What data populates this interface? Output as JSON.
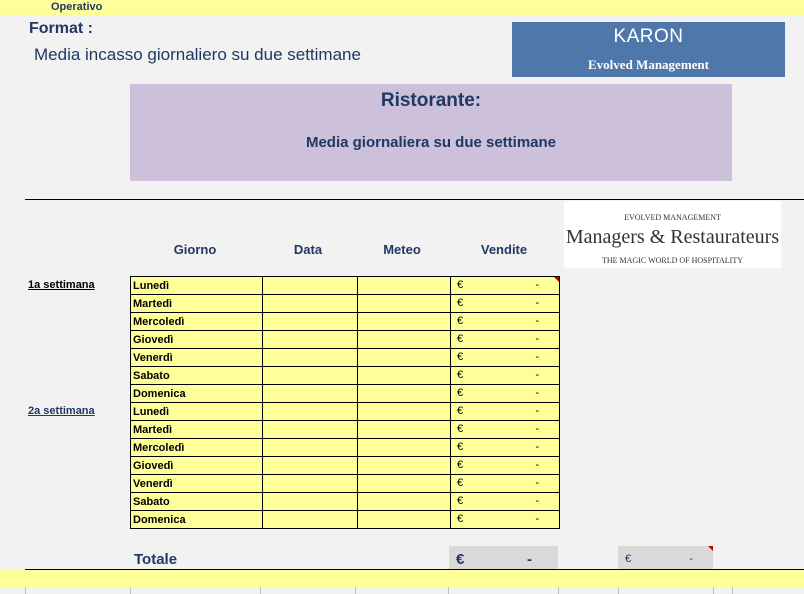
{
  "header": {
    "operativo": "Operativo",
    "format_label": "Format :",
    "format_desc": "Media incasso giornaliero su due settimane"
  },
  "brand": {
    "name": "KARON",
    "subtitle": "Evolved Management"
  },
  "banner": {
    "title": "Ristorante:",
    "subtitle": "Media giornaliera su due settimane"
  },
  "logo": {
    "top": "EVOLVED MANAGEMENT",
    "main": "Managers & Restaurateurs",
    "bottom": "THE MAGIC WORLD OF HOSPITALITY"
  },
  "columns": {
    "giorno": "Giorno",
    "data": "Data",
    "meteo": "Meteo",
    "vendite": "Vendite"
  },
  "weeks": {
    "week1": "1a settimana",
    "week2": "2a settimana"
  },
  "rows": [
    {
      "day": "Lunedì",
      "data": "",
      "meteo": "",
      "currency": "€",
      "value": "-"
    },
    {
      "day": "Martedì",
      "data": "",
      "meteo": "",
      "currency": "€",
      "value": "-"
    },
    {
      "day": "Mercoledì",
      "data": "",
      "meteo": "",
      "currency": "€",
      "value": "-"
    },
    {
      "day": "Giovedì",
      "data": "",
      "meteo": "",
      "currency": "€",
      "value": "-"
    },
    {
      "day": "Venerdì",
      "data": "",
      "meteo": "",
      "currency": "€",
      "value": "-"
    },
    {
      "day": "Sabato",
      "data": "",
      "meteo": "",
      "currency": "€",
      "value": "-"
    },
    {
      "day": "Domenica",
      "data": "",
      "meteo": "",
      "currency": "€",
      "value": "-"
    },
    {
      "day": "Lunedì",
      "data": "",
      "meteo": "",
      "currency": "€",
      "value": "-"
    },
    {
      "day": "Martedì",
      "data": "",
      "meteo": "",
      "currency": "€",
      "value": "-"
    },
    {
      "day": "Mercoledì",
      "data": "",
      "meteo": "",
      "currency": "€",
      "value": "-"
    },
    {
      "day": "Giovedì",
      "data": "",
      "meteo": "",
      "currency": "€",
      "value": "-"
    },
    {
      "day": "Venerdì",
      "data": "",
      "meteo": "",
      "currency": "€",
      "value": "-"
    },
    {
      "day": "Sabato",
      "data": "",
      "meteo": "",
      "currency": "€",
      "value": "-"
    },
    {
      "day": "Domenica",
      "data": "",
      "meteo": "",
      "currency": "€",
      "value": "-"
    }
  ],
  "totals": {
    "label": "Totale",
    "currency": "€",
    "value": "-",
    "avg_currency": "€",
    "avg_value": "-"
  },
  "colors": {
    "cell_yellow": "#ffff99",
    "brand_blue": "#4f77aa",
    "banner_lilac": "#ccc0da",
    "text_navy": "#1f3864",
    "comment_red": "#c00000"
  }
}
